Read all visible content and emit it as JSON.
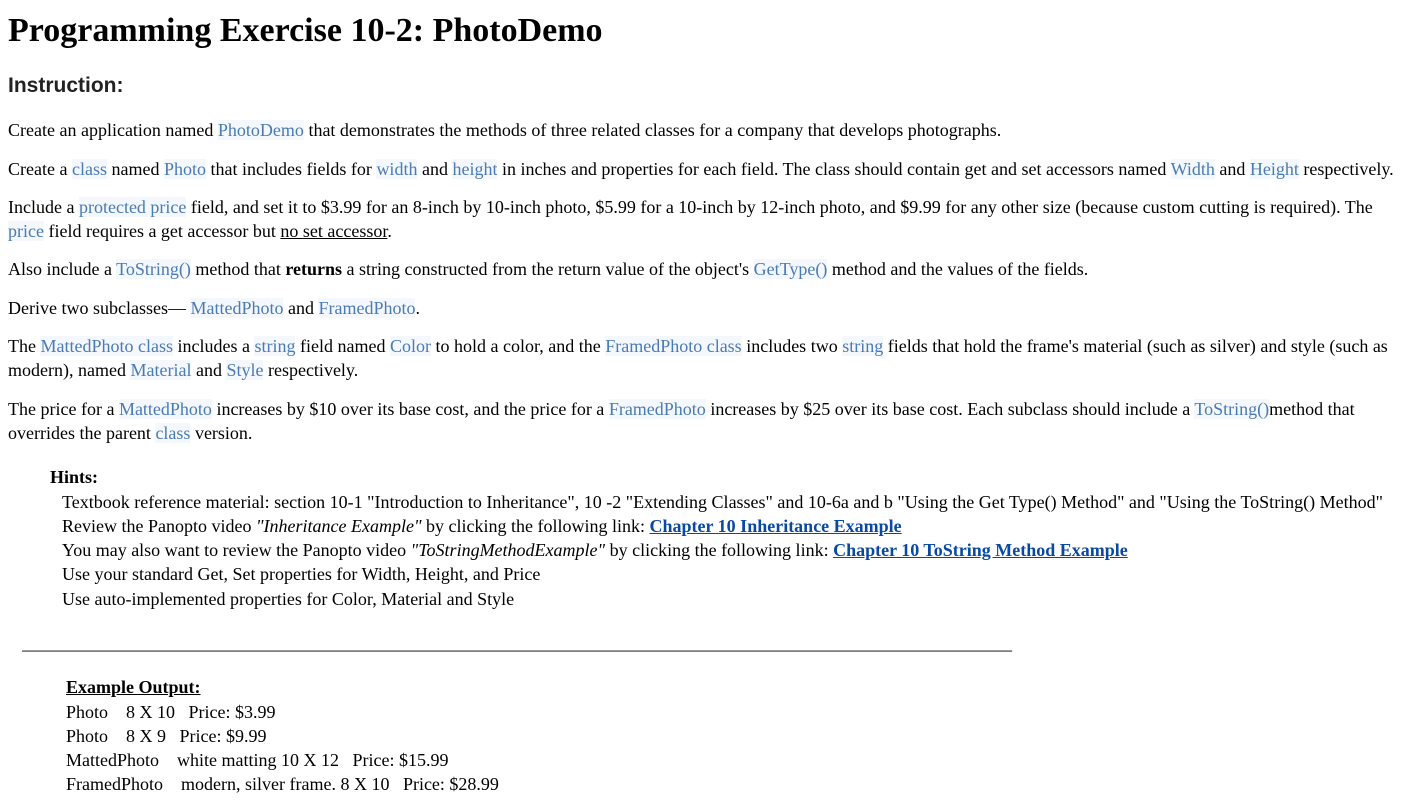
{
  "title": "Programming Exercise 10-2:  PhotoDemo",
  "subtitle": "Instruction:",
  "p1": {
    "t0": "Create an application named ",
    "c0": "PhotoDemo",
    "t1": " that demonstrates the methods of three related classes for a company that develops photographs."
  },
  "p2": {
    "t0": "Create a ",
    "c0": "class",
    "t1": " named ",
    "c1": "Photo",
    "t2": " that includes fields for ",
    "c2": "width",
    "t3": " and ",
    "c3": "height",
    "t4": " in inches and properties for each field. The class should contain get and set accessors named ",
    "c4": "Width",
    "t5": " and ",
    "c5": "Height",
    "t6": " respectively."
  },
  "p3": {
    "t0": "Include a ",
    "c0": "protected price",
    "t1": " field, and set it to $3.99 for an 8-inch by 10-inch photo, $5.99 for a 10-inch by 12-inch photo, and $9.99 for any other size (because custom cutting is required). The ",
    "c1": "price",
    "t2": " field requires a get accessor but ",
    "u0": "no set accessor",
    "t3": "."
  },
  "p4": {
    "t0": "Also include a ",
    "c0": "ToString()",
    "t1": " method that ",
    "b0": "returns",
    "t2": " a string constructed from the return value of the object's ",
    "c1": "GetType()",
    "t3": " method and the values of the fields."
  },
  "p5": {
    "t0": "Derive two subclasses— ",
    "c0": "MattedPhoto",
    "t1": " and ",
    "c1": "FramedPhoto",
    "t2": "."
  },
  "p6": {
    "t0": "The ",
    "c0": "MattedPhoto class",
    "t1": " includes a ",
    "c1": "string",
    "t2": " field named ",
    "c2": "Color",
    "t3": " to hold a color, and the ",
    "c3": "FramedPhoto class",
    "t4": " includes two ",
    "c4": "string",
    "t5": " fields that hold the frame's material (such as silver) and style (such as modern), named ",
    "c5": "Material",
    "t6": " and ",
    "c6": "Style",
    "t7": " respectively."
  },
  "p7": {
    "t0": "The price for a ",
    "c0": "MattedPhoto",
    "t1": " increases by $10 over its base cost, and the price for a ",
    "c1": "FramedPhoto",
    "t2": " increases by $25 over its base cost. Each subclass should include a ",
    "c2": "ToString()",
    "t3": "method that overrides the parent ",
    "c3": "class",
    "t4": " version."
  },
  "hints": {
    "title": "Hints:",
    "l1": "Textbook reference material: section 10-1 \"Introduction to Inheritance\", 10 -2 \"Extending Classes\" and 10-6a and b \"Using the Get Type() Method\" and \"Using the ToString() Method\"",
    "l2a": "Review the Panopto video ",
    "l2i": "\"Inheritance Example\"",
    "l2b": " by clicking the following link: ",
    "l2link": "Chapter 10 Inheritance Example",
    "l3a": "You may also want to review the Panopto video ",
    "l3i": "\"ToStringMethodExample\"",
    "l3b": " by clicking the following link: ",
    "l3link": "Chapter 10 ToString Method Example",
    "l4": "Use your standard Get, Set properties for Width, Height, and Price",
    "l5": "Use auto-implemented properties for Color, Material and Style"
  },
  "hr": "______________________________________________________________________________________________________________",
  "example": {
    "title": "Example  Output:",
    "lines": [
      "Photo    8 X 10   Price: $3.99",
      "Photo    8 X 9   Price: $9.99",
      "MattedPhoto    white matting 10 X 12   Price: $15.99",
      "FramedPhoto    modern, silver frame. 8 X 10   Price: $28.99"
    ]
  }
}
